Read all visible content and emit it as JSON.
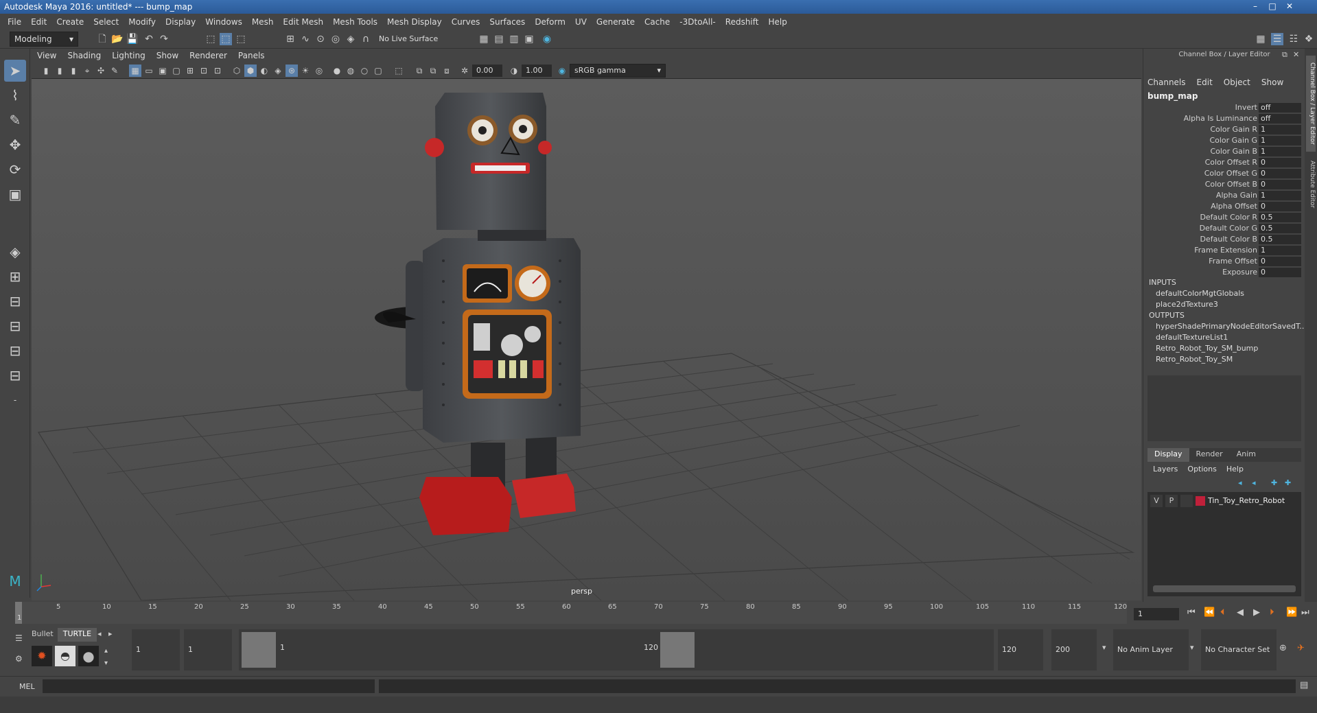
{
  "window": {
    "title": "Autodesk Maya 2016: untitled*   ---   bump_map"
  },
  "menubar": {
    "items": [
      "File",
      "Edit",
      "Create",
      "Select",
      "Modify",
      "Display",
      "Windows",
      "Mesh",
      "Edit Mesh",
      "Mesh Tools",
      "Mesh Display",
      "Curves",
      "Surfaces",
      "Deform",
      "UV",
      "Generate",
      "Cache",
      "-3DtoAll-",
      "Redshift",
      "Help"
    ]
  },
  "statusline": {
    "mode": "Modeling",
    "live_surface": "No Live Surface"
  },
  "panel": {
    "menu": [
      "View",
      "Shading",
      "Lighting",
      "Show",
      "Renderer",
      "Panels"
    ],
    "exposure": "0.00",
    "gamma": "1.00",
    "colorspace": "sRGB gamma",
    "camera_label": "persp"
  },
  "channelbox": {
    "header": "Channel Box / Layer Editor",
    "menu": [
      "Channels",
      "Edit",
      "Object",
      "Show"
    ],
    "node_name": "bump_map",
    "attributes": [
      {
        "label": "Invert",
        "value": "off"
      },
      {
        "label": "Alpha Is Luminance",
        "value": "off"
      },
      {
        "label": "Color Gain R",
        "value": "1"
      },
      {
        "label": "Color Gain G",
        "value": "1"
      },
      {
        "label": "Color Gain B",
        "value": "1"
      },
      {
        "label": "Color Offset R",
        "value": "0"
      },
      {
        "label": "Color Offset G",
        "value": "0"
      },
      {
        "label": "Color Offset B",
        "value": "0"
      },
      {
        "label": "Alpha Gain",
        "value": "1"
      },
      {
        "label": "Alpha Offset",
        "value": "0"
      },
      {
        "label": "Default Color R",
        "value": "0.5"
      },
      {
        "label": "Default Color G",
        "value": "0.5"
      },
      {
        "label": "Default Color B",
        "value": "0.5"
      },
      {
        "label": "Frame Extension",
        "value": "1"
      },
      {
        "label": "Frame Offset",
        "value": "0"
      },
      {
        "label": "Exposure",
        "value": "0"
      }
    ],
    "inputs_label": "INPUTS",
    "inputs": [
      "defaultColorMgtGlobals",
      "place2dTexture3"
    ],
    "outputs_label": "OUTPUTS",
    "outputs": [
      "hyperShadePrimaryNodeEditorSavedT...",
      "defaultTextureList1",
      "Retro_Robot_Toy_SM_bump",
      "Retro_Robot_Toy_SM"
    ]
  },
  "layereditor": {
    "tabs": [
      "Display",
      "Render",
      "Anim"
    ],
    "menu": [
      "Layers",
      "Options",
      "Help"
    ],
    "layer": {
      "v": "V",
      "p": "P",
      "name": "Tin_Toy_Retro_Robot",
      "color": "#c0203a"
    }
  },
  "sidetabs": [
    "Channel Box / Layer Editor",
    "Attribute Editor"
  ],
  "timeline": {
    "ticks": [
      "1",
      "5",
      "10",
      "15",
      "20",
      "25",
      "30",
      "35",
      "40",
      "45",
      "50",
      "55",
      "60",
      "65",
      "70",
      "75",
      "80",
      "85",
      "90",
      "95",
      "100",
      "105",
      "110",
      "115",
      "120"
    ],
    "current_frame": "1"
  },
  "range": {
    "shelf_tabs": [
      "Bullet",
      "TURTLE"
    ],
    "start": "1",
    "playback_start": "1",
    "range_start_label": "1",
    "range_end_label": "120",
    "playback_end": "120",
    "end": "200",
    "anim_layer": "No Anim Layer",
    "char_set": "No Character Set"
  },
  "cmdline": {
    "label": "MEL"
  }
}
